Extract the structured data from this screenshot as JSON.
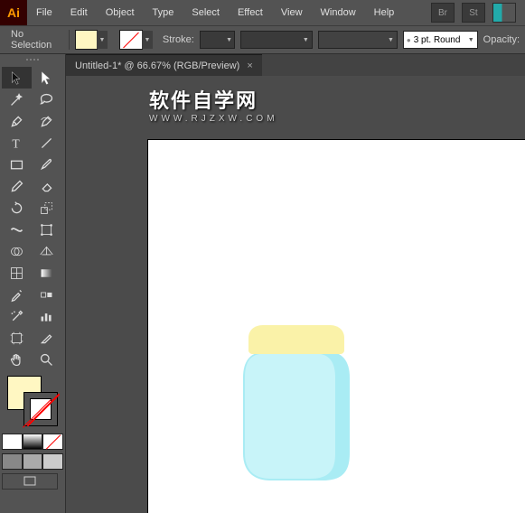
{
  "menubar": {
    "app_icon": "Ai",
    "items": [
      "File",
      "Edit",
      "Object",
      "Type",
      "Select",
      "Effect",
      "View",
      "Window",
      "Help"
    ],
    "right_icons": [
      "Br",
      "St"
    ]
  },
  "controlbar": {
    "selection_label": "No Selection",
    "stroke_label": "Stroke:",
    "stroke_value": "",
    "profile_value": "3 pt. Round",
    "opacity_label": "Opacity:"
  },
  "toolbox": {
    "tools": [
      "selection-tool",
      "direct-selection-tool",
      "magic-wand-tool",
      "lasso-tool",
      "pen-tool",
      "curvature-tool",
      "type-tool",
      "line-segment-tool",
      "rectangle-tool",
      "paintbrush-tool",
      "pencil-tool",
      "eraser-tool",
      "rotate-tool",
      "scale-tool",
      "width-tool",
      "free-transform-tool",
      "shape-builder-tool",
      "perspective-grid-tool",
      "mesh-tool",
      "gradient-tool",
      "eyedropper-tool",
      "blend-tool",
      "symbol-sprayer-tool",
      "column-graph-tool",
      "artboard-tool",
      "slice-tool",
      "hand-tool",
      "zoom-tool"
    ]
  },
  "tabs": {
    "active": {
      "title": "Untitled-1* @ 66.67% (RGB/Preview)"
    }
  },
  "watermark": {
    "line1": "软件自学网",
    "line2": "WWW.RJZXW.COM"
  },
  "colors": {
    "fill": "#fff7c2",
    "jar_lid": "#faf2a8",
    "jar_body_light": "#c8f4f9",
    "jar_body_dark": "#a9ecf4"
  }
}
